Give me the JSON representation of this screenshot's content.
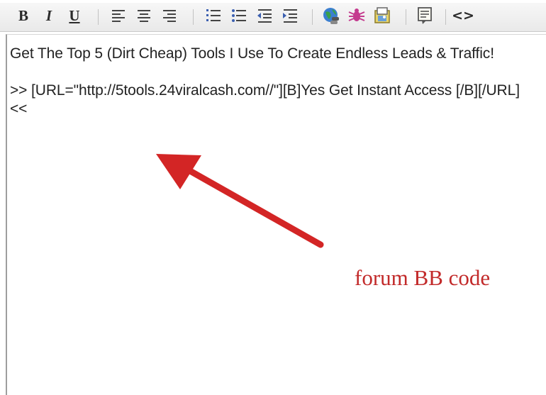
{
  "toolbar": {
    "bold_label": "B",
    "italic_label": "I",
    "underline_label": "U",
    "code_label": "<>"
  },
  "editor": {
    "line1": "Get The Top 5 (Dirt Cheap) Tools I Use To Create Endless Leads & Traffic!",
    "line2": ">> [URL=\"http://5tools.24viralcash.com//\"][B]Yes Get Instant Access [/B][/URL] <<"
  },
  "annotation": {
    "text": "forum BB code",
    "color": "#c22a2a"
  },
  "icons": [
    "bold-icon",
    "italic-icon",
    "underline-icon",
    "align-left-icon",
    "align-center-icon",
    "align-right-icon",
    "ordered-list-icon",
    "unordered-list-icon",
    "outdent-icon",
    "indent-icon",
    "insert-link-icon",
    "remove-link-icon",
    "insert-image-icon",
    "quote-icon",
    "code-icon"
  ]
}
